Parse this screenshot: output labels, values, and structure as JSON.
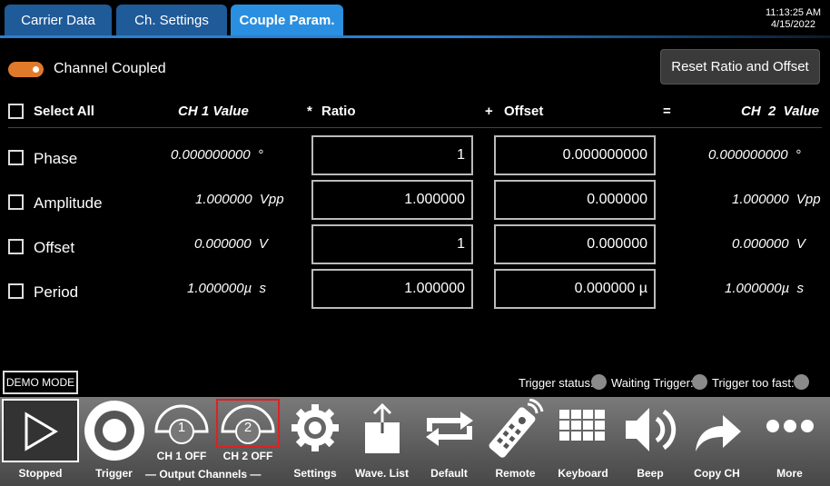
{
  "tabs": [
    {
      "label": "Carrier Data",
      "active": false
    },
    {
      "label": "Ch. Settings",
      "active": false
    },
    {
      "label": "Couple Param.",
      "active": true
    }
  ],
  "clock": {
    "time": "11:13:25 AM",
    "date": "4/15/2022"
  },
  "coupling": {
    "toggle_label": "Channel Coupled",
    "on": true,
    "reset_label": "Reset Ratio and Offset"
  },
  "header": {
    "select_all": "Select All",
    "ch1": "CH 1 Value",
    "mul": "*",
    "ratio": "Ratio",
    "plus": "+",
    "offset": "Offset",
    "eq": "=",
    "ch2": "CH  2  Value"
  },
  "rows": [
    {
      "label": "Phase",
      "ch1": "0.000000000  °",
      "ratio": "1",
      "offset": "0.000000000",
      "ch2": "0.000000000  °"
    },
    {
      "label": "Amplitude",
      "ch1": "1.000000  Vpp",
      "ratio": "1.000000",
      "offset": "0.000000",
      "ch2": "1.000000  Vpp"
    },
    {
      "label": "Offset",
      "ch1": "0.000000  V",
      "ratio": "1",
      "offset": "0.000000",
      "ch2": "0.000000  V"
    },
    {
      "label": "Period",
      "ch1": "1.000000µ  s",
      "ratio": "1.000000",
      "offset": "0.000000 µ",
      "ch2": "1.000000µ  s"
    }
  ],
  "demo_mode": "DEMO MODE",
  "trigger_status": {
    "status_label": "Trigger status:",
    "waiting_label": "Waiting Trigger:",
    "fast_label": "Trigger too fast:"
  },
  "toolbar": {
    "stopped": "Stopped",
    "trigger": "Trigger",
    "ch1_off": "CH 1 OFF",
    "ch2_off": "CH 2 OFF",
    "ch1_num": "1",
    "ch2_num": "2",
    "output_channels": "— Output Channels —",
    "settings": "Settings",
    "wave_list": "Wave. List",
    "default": "Default",
    "remote": "Remote",
    "keyboard": "Keyboard",
    "beep": "Beep",
    "copy_ch": "Copy CH",
    "more": "More"
  },
  "colors": {
    "tab": "#1f5a99",
    "tab_active": "#2a8fe0",
    "toggle": "#e07a2a",
    "ch2_highlight": "#e02020"
  }
}
